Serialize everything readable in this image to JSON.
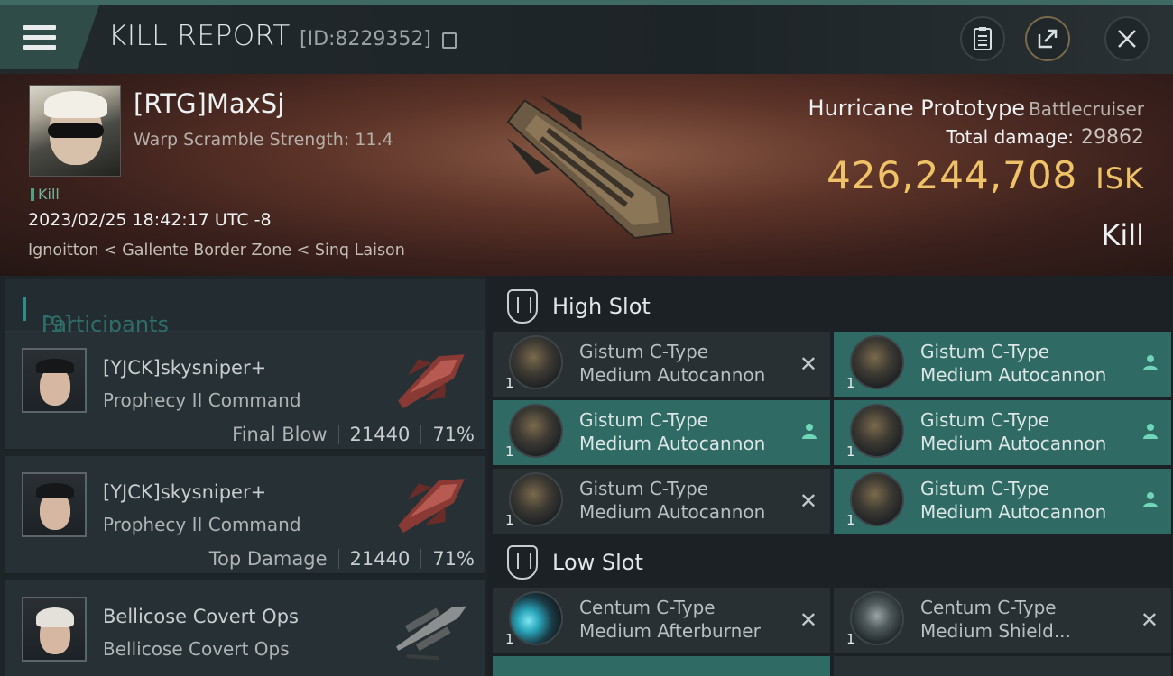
{
  "header": {
    "title": "KILL REPORT",
    "report_id": "[ID:8229352]",
    "icons": [
      "menu-icon",
      "copy-icon",
      "clipboard-icon",
      "share-icon",
      "close-icon"
    ]
  },
  "victim": {
    "name": "[RTG]MaxSj",
    "scramble": "Warp Scramble Strength: 11.4",
    "tag": "Kill",
    "datetime": "2023/02/25 18:42:17 UTC -8",
    "location": "Ignoitton < Gallente Border Zone < Sinq Laison",
    "ship_name": "Hurricane Prototype",
    "ship_class": "Battlecruiser",
    "total_damage_label": "Total damage:",
    "total_damage": "29862",
    "isk_value": "426,244,708",
    "isk_unit": "ISK",
    "result": "Kill"
  },
  "participants": {
    "label": "Participants",
    "count": "[9]",
    "items": [
      {
        "name": "[YJCK]skysniper+",
        "ship": "Prophecy II Command",
        "role": "Final Blow",
        "damage": "21440",
        "percent": "71%"
      },
      {
        "name": "[YJCK]skysniper+",
        "ship": "Prophecy II Command",
        "role": "Top Damage",
        "damage": "21440",
        "percent": "71%"
      },
      {
        "name": "Bellicose Covert Ops",
        "ship": "Bellicose Covert Ops",
        "role": "",
        "damage": "",
        "percent": ""
      }
    ]
  },
  "high_slot": {
    "title": "High Slot",
    "modules": [
      {
        "line1": "Gistum C-Type",
        "line2": "Medium Autocannon",
        "qty": "1",
        "status": "✕",
        "highlight": false
      },
      {
        "line1": "Gistum C-Type",
        "line2": "Medium Autocannon",
        "qty": "1",
        "status": "person",
        "highlight": true
      },
      {
        "line1": "Gistum C-Type",
        "line2": "Medium Autocannon",
        "qty": "1",
        "status": "person",
        "highlight": true
      },
      {
        "line1": "Gistum C-Type",
        "line2": "Medium Autocannon",
        "qty": "1",
        "status": "person",
        "highlight": true
      },
      {
        "line1": "Gistum C-Type",
        "line2": "Medium Autocannon",
        "qty": "1",
        "status": "✕",
        "highlight": false
      },
      {
        "line1": "Gistum C-Type",
        "line2": "Medium Autocannon",
        "qty": "1",
        "status": "person",
        "highlight": true
      }
    ]
  },
  "low_slot": {
    "title": "Low Slot",
    "modules": [
      {
        "line1": "Centum C-Type",
        "line2": "Medium Afterburner",
        "qty": "1",
        "status": "✕",
        "highlight": false
      },
      {
        "line1": "Centum C-Type",
        "line2": "Medium Shield...",
        "qty": "1",
        "status": "✕",
        "highlight": false
      }
    ]
  }
}
